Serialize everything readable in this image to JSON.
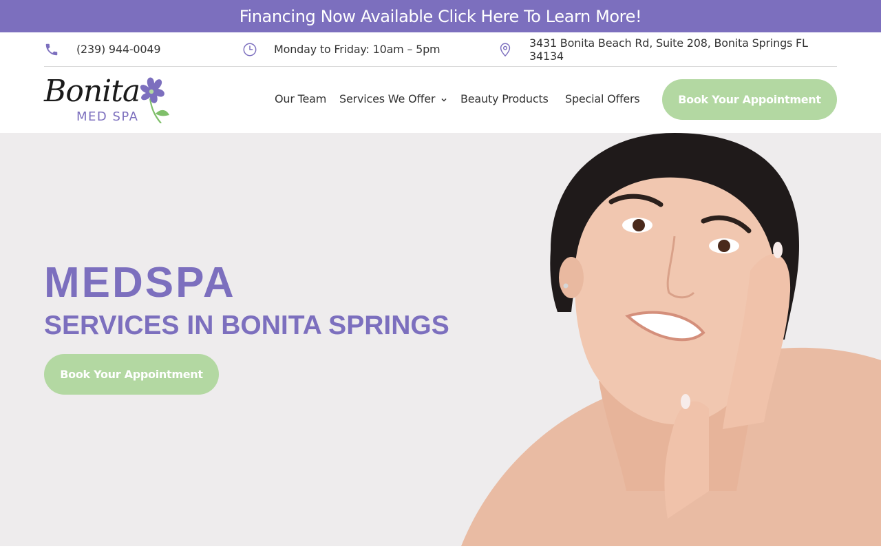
{
  "banner": {
    "text": "Financing Now Available Click Here To Learn More!"
  },
  "info": {
    "phone": "(239) 944-0049",
    "hours": "Monday to Friday: 10am – 5pm",
    "address": "3431 Bonita Beach Rd, Suite 208, Bonita Springs FL 34134"
  },
  "logo": {
    "script": "Bonita",
    "sub": "MED SPA"
  },
  "nav": {
    "team": "Our Team",
    "services": "Services We Offer",
    "beauty": "Beauty Products",
    "offers": "Special Offers"
  },
  "header_button": "Book Your Appointment",
  "hero": {
    "title": "MEDSPA",
    "subtitle": "SERVICES IN BONITA SPRINGS",
    "button": "Book Your Appointment"
  },
  "colors": {
    "brand_purple": "#7c6fbe",
    "button_green": "#b3d8a2",
    "hero_bg": "#eeeced"
  }
}
